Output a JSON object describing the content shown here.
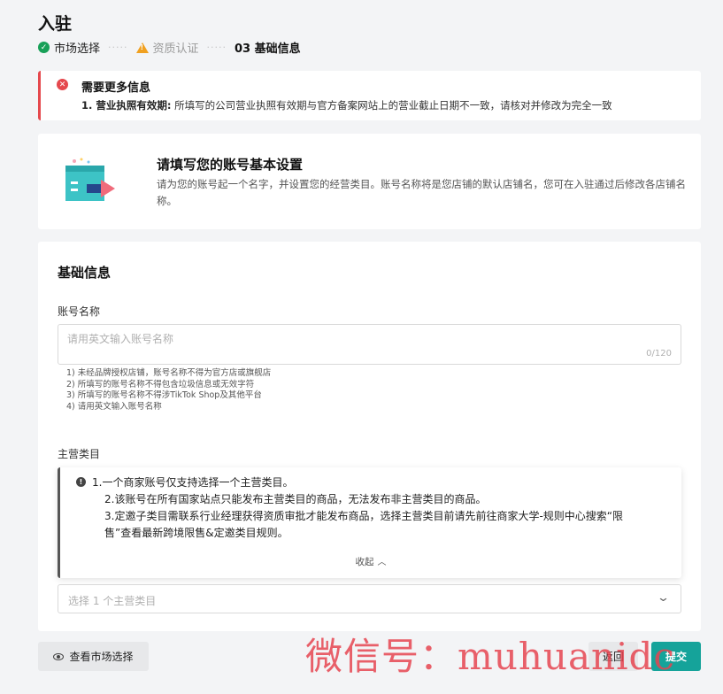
{
  "page": {
    "title": "入驻"
  },
  "steps": [
    {
      "label": "市场选择",
      "status": "done",
      "icon": "check-circle-icon"
    },
    {
      "label": "资质认证",
      "status": "warning",
      "icon": "warning-icon"
    },
    {
      "label": "03 基础信息",
      "status": "current"
    }
  ],
  "alert": {
    "title": "需要更多信息",
    "item_prefix": "1. 营业执照有效期:",
    "item_text": " 所填写的公司营业执照有效期与官方备案网站上的营业截止日期不一致，请核对并修改为完全一致",
    "color": "#e5484d"
  },
  "intro": {
    "title": "请填写您的账号基本设置",
    "description": "请为您的账号起一个名字，并设置您的经营类目。账号名称将是您店铺的默认店铺名，您可在入驻通过后修改各店铺名称。"
  },
  "form": {
    "section_title": "基础信息",
    "account_name": {
      "label": "账号名称",
      "placeholder": "请用英文输入账号名称",
      "value": "",
      "counter": "0/120",
      "rules": [
        "1) 未经品牌授权店铺，账号名称不得为官方店或旗舰店",
        "2) 所填写的账号名称不得包含垃圾信息或无效字符",
        "3) 所填写的账号名称不得涉TikTok Shop及其他平台",
        "4) 请用英文输入账号名称"
      ]
    },
    "main_category": {
      "label": "主营类目",
      "info_lines": [
        "1.一个商家账号仅支持选择一个主营类目。",
        "2.该账号在所有国家站点只能发布主营类目的商品，无法发布非主营类目的商品。",
        "3.定邀子类目需联系行业经理获得资质审批才能发布商品，选择主营类目前请先前往商家大学-规则中心搜索“限",
        "售”查看最新跨境限售&定邀类目规则。"
      ],
      "collapse_label": "收起",
      "select_placeholder": "选择 1 个主营类目"
    }
  },
  "footer": {
    "view_market_label": "查看市场选择",
    "back_label": "返回",
    "submit_label": "提交",
    "accent_color": "#15a39a"
  },
  "watermark": "微信号：muhuanidc"
}
